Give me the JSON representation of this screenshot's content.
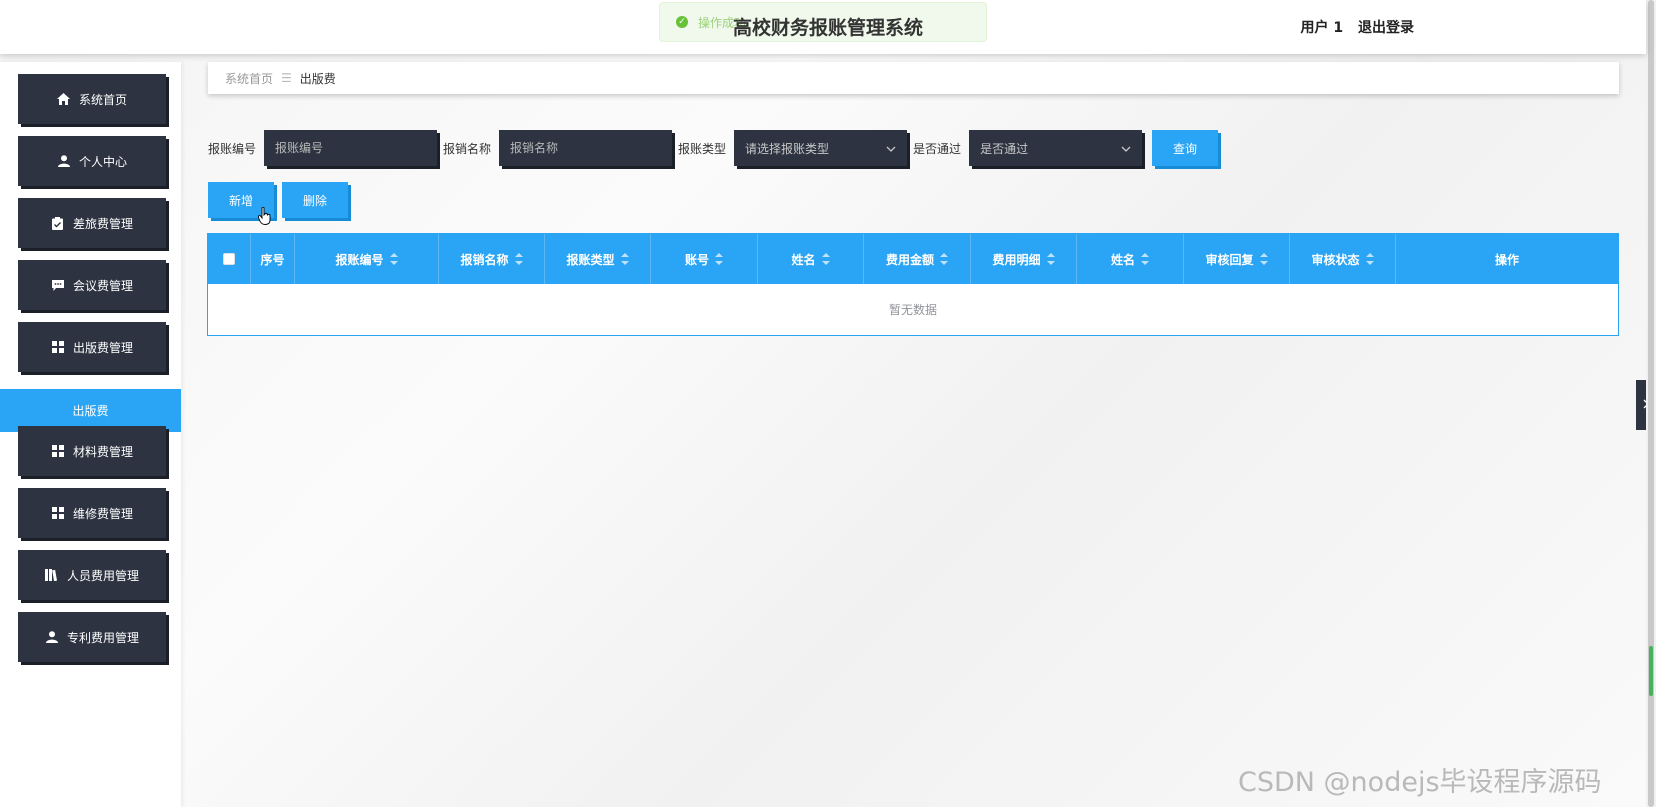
{
  "header": {
    "toast": "操作成功",
    "title": "高校财务报账管理系统",
    "user": "用户 1",
    "logout": "退出登录"
  },
  "sidebar": {
    "items": [
      {
        "label": "系统首页",
        "icon": "home-icon"
      },
      {
        "label": "个人中心",
        "icon": "user-icon"
      },
      {
        "label": "差旅费管理",
        "icon": "clipboard-icon"
      },
      {
        "label": "会议费管理",
        "icon": "chat-icon"
      },
      {
        "label": "出版费管理",
        "icon": "grid-icon"
      },
      {
        "label": "材料费管理",
        "icon": "grid-icon"
      },
      {
        "label": "维修费管理",
        "icon": "grid-icon"
      },
      {
        "label": "人员费用管理",
        "icon": "book-icon"
      },
      {
        "label": "专利费用管理",
        "icon": "user-icon"
      }
    ],
    "active_sub": "出版费"
  },
  "breadcrumb": {
    "home": "系统首页",
    "separator": "☰",
    "current": "出版费"
  },
  "search": {
    "code_label": "报账编号",
    "code_placeholder": "报账编号",
    "name_label": "报销名称",
    "name_placeholder": "报销名称",
    "type_label": "报账类型",
    "type_placeholder": "请选择报账类型",
    "passed_label": "是否通过",
    "passed_placeholder": "是否通过",
    "query_button": "查询"
  },
  "actions": {
    "add_button": "新增",
    "delete_button": "删除"
  },
  "table": {
    "columns": [
      "序号",
      "报账编号",
      "报销名称",
      "报账类型",
      "账号",
      "姓名",
      "费用金额",
      "费用明细",
      "姓名",
      "审核回复",
      "审核状态",
      "操作"
    ],
    "empty_text": "暂无数据"
  },
  "watermark": "CSDN @nodejs毕设程序源码",
  "colors": {
    "accent": "#2aa4f4",
    "dark": "#2d3340"
  }
}
